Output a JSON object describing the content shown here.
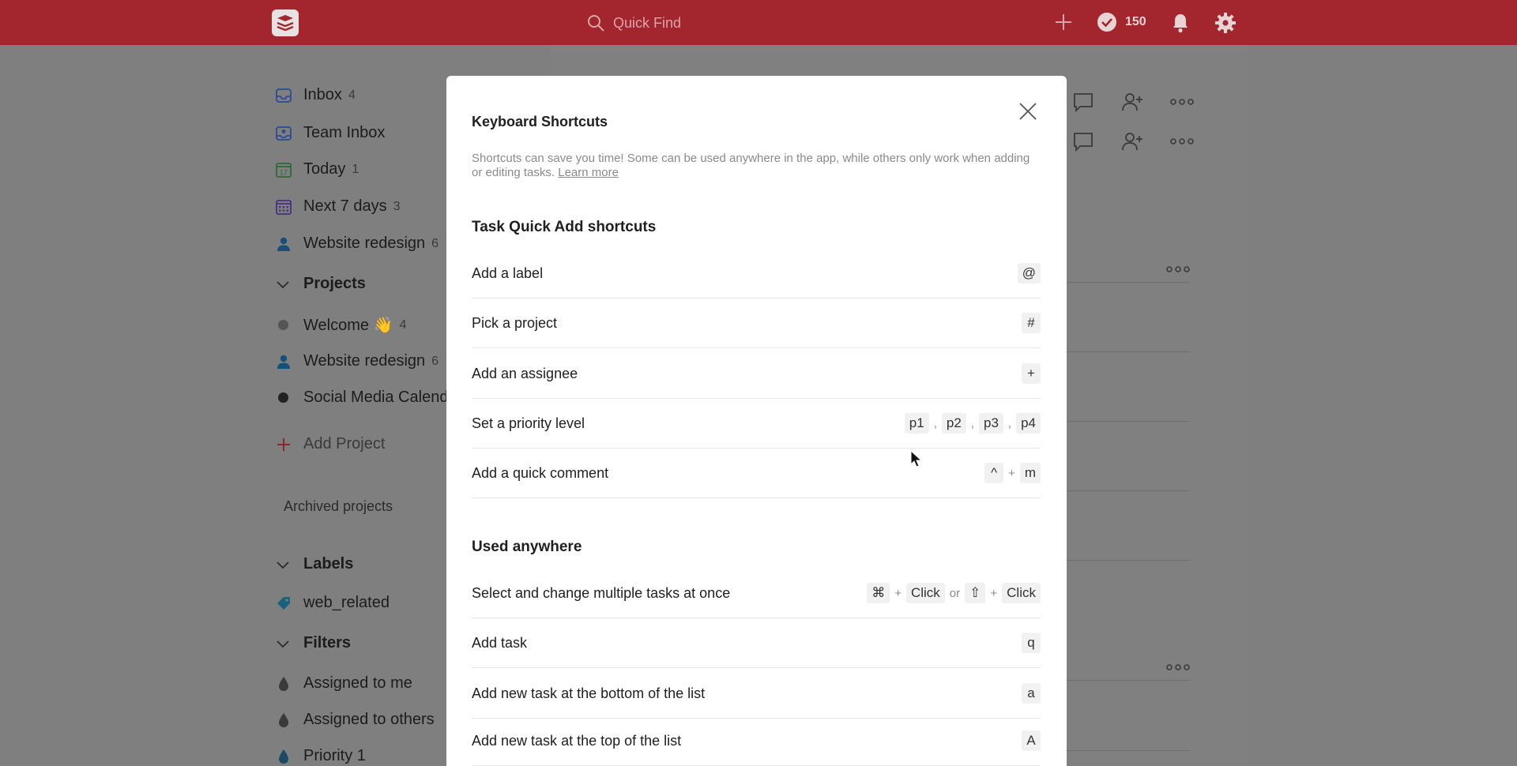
{
  "topbar": {
    "search_placeholder": "Quick Find",
    "karma_count": "150",
    "icons": [
      "logo-icon",
      "search-icon",
      "add-icon",
      "karma-check-icon",
      "bell-icon",
      "gear-icon"
    ]
  },
  "sidebar": {
    "items": [
      {
        "label": "Inbox",
        "count": "4",
        "icon": "inbox-icon"
      },
      {
        "label": "Team Inbox",
        "count": "",
        "icon": "team-inbox-icon"
      },
      {
        "label": "Today",
        "count": "1",
        "icon": "today-calendar-icon",
        "day": "17"
      },
      {
        "label": "Next 7 days",
        "count": "3",
        "icon": "week-calendar-icon"
      },
      {
        "label": "Website redesign",
        "count": "6",
        "icon": "person-icon"
      }
    ],
    "projects_heading": "Projects",
    "projects": [
      {
        "label": "Welcome 👋",
        "count": "4"
      },
      {
        "label": "Website redesign",
        "count": "6"
      },
      {
        "label": "Social Media Calenda",
        "count": ""
      }
    ],
    "add_project": "Add Project",
    "archived": "Archived projects",
    "labels_heading": "Labels",
    "labels": [
      {
        "label": "web_related"
      }
    ],
    "filters_heading": "Filters",
    "filters": [
      {
        "label": "Assigned to me"
      },
      {
        "label": "Assigned to others"
      },
      {
        "label": "Priority 1"
      }
    ]
  },
  "modal": {
    "title": "Keyboard Shortcuts",
    "description": "Shortcuts can save you time! Some can be used anywhere in the app, while others only work when adding or editing tasks.",
    "learn_more": "Learn more",
    "sections": [
      {
        "heading": "Task Quick Add shortcuts",
        "rows": [
          {
            "label": "Add a label",
            "keys": [
              "@"
            ]
          },
          {
            "label": "Pick a project",
            "keys": [
              "#"
            ]
          },
          {
            "label": "Add an assignee",
            "keys": [
              "+"
            ]
          },
          {
            "label": "Set a priority level",
            "keys": [
              "p1",
              ",",
              "p2",
              ",",
              "p3",
              ",",
              "p4"
            ]
          },
          {
            "label": "Add a quick comment",
            "keys": [
              "^",
              "+",
              "m"
            ]
          }
        ]
      },
      {
        "heading": "Used anywhere",
        "rows": [
          {
            "label": "Select and change multiple tasks at once",
            "keys": [
              "⌘",
              "+",
              "Click",
              "or",
              "⇧",
              "+",
              "Click"
            ]
          },
          {
            "label": "Add task",
            "keys": [
              "q"
            ]
          },
          {
            "label": "Add new task at the bottom of the list",
            "keys": [
              "a"
            ]
          },
          {
            "label": "Add new task at the top of the list",
            "keys": [
              "A"
            ]
          }
        ]
      }
    ]
  },
  "colors": {
    "topbar": "#a3262f",
    "overlay": "#7f7f7f",
    "modal": "#ffffff"
  }
}
